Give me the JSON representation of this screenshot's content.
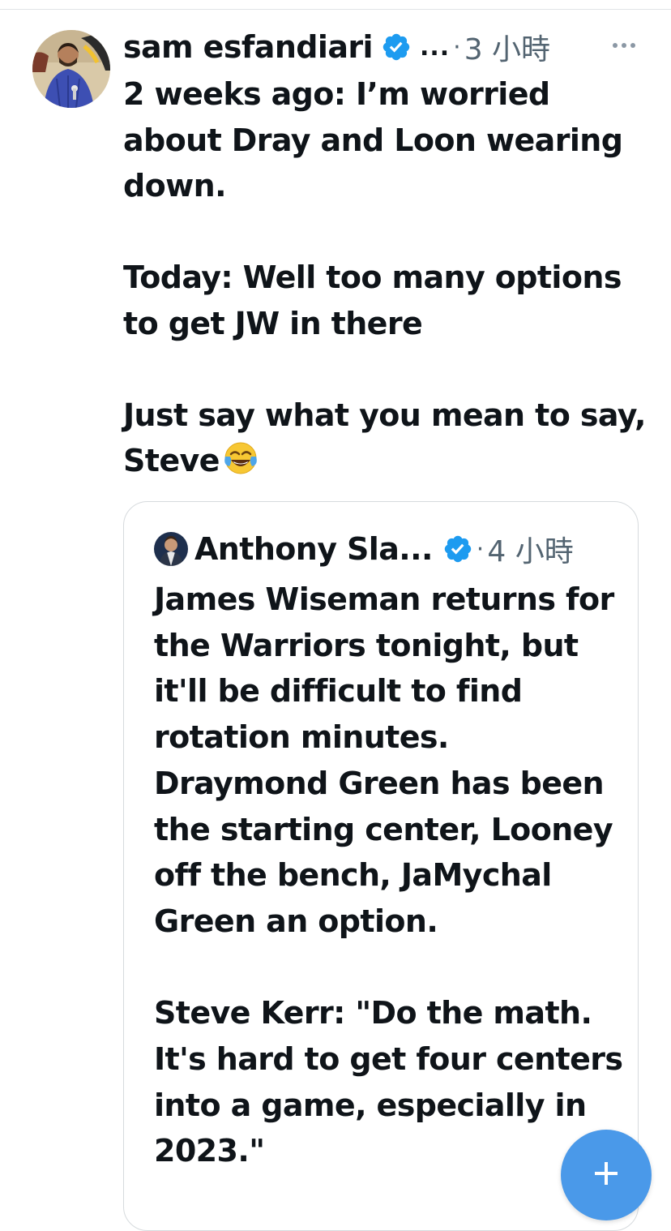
{
  "tweet": {
    "author": {
      "display_name": "sam esfandiari",
      "handle_truncated": "...",
      "verified": true,
      "avatar_icon": "profile-photo"
    },
    "separator": "·",
    "timestamp": "3 小時",
    "more_icon": "ellipsis-icon",
    "text": "2 weeks ago: I’m worried about Dray and Loon wearing down.\n\nToday: Well too many options to get JW in there\n\nJust say what you mean to say, Steve",
    "emoji": "face-with-tears-of-joy"
  },
  "quoted_tweet": {
    "author": {
      "display_name": "Anthony Sla...",
      "verified": true,
      "avatar_icon": "profile-photo"
    },
    "separator": "·",
    "timestamp": "4 小時",
    "text": "James Wiseman returns for the Warriors tonight, but it'll be difficult to find rotation minutes. Draymond Green has been the starting center, Looney off the bench, JaMychal Green an option.\n\nSteve Kerr: \"Do the math. It's hard to get four centers into a game, especially in 2023.\""
  },
  "compose_button": {
    "icon": "plus-icon"
  },
  "colors": {
    "verified_blue": "#1d9bf0",
    "text": "#0f1419",
    "secondary_text": "#536471",
    "fab": "#4a99e9",
    "border": "#d6dadd"
  }
}
